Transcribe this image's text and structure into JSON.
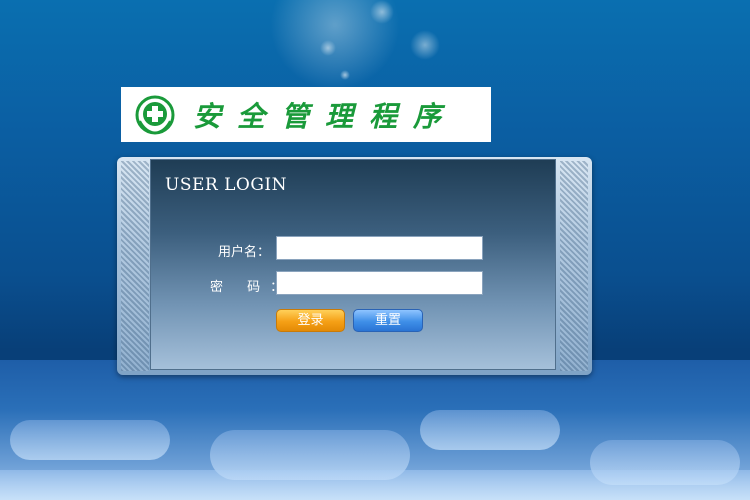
{
  "logo": {
    "title": "安全管理程序",
    "icon": "green-cross-icon",
    "color": "#1a9a3a"
  },
  "login": {
    "heading": "USER LOGIN",
    "username_label": "用户名：",
    "password_label": "密  码：",
    "username_value": "",
    "password_value": "",
    "login_button": "登录",
    "reset_button": "重置"
  },
  "colors": {
    "background_top": "#0a6fb0",
    "background_bottom": "#083f78",
    "login_button": "#f5a016",
    "reset_button": "#3f8fe8",
    "panel": "#3c5f7e"
  }
}
